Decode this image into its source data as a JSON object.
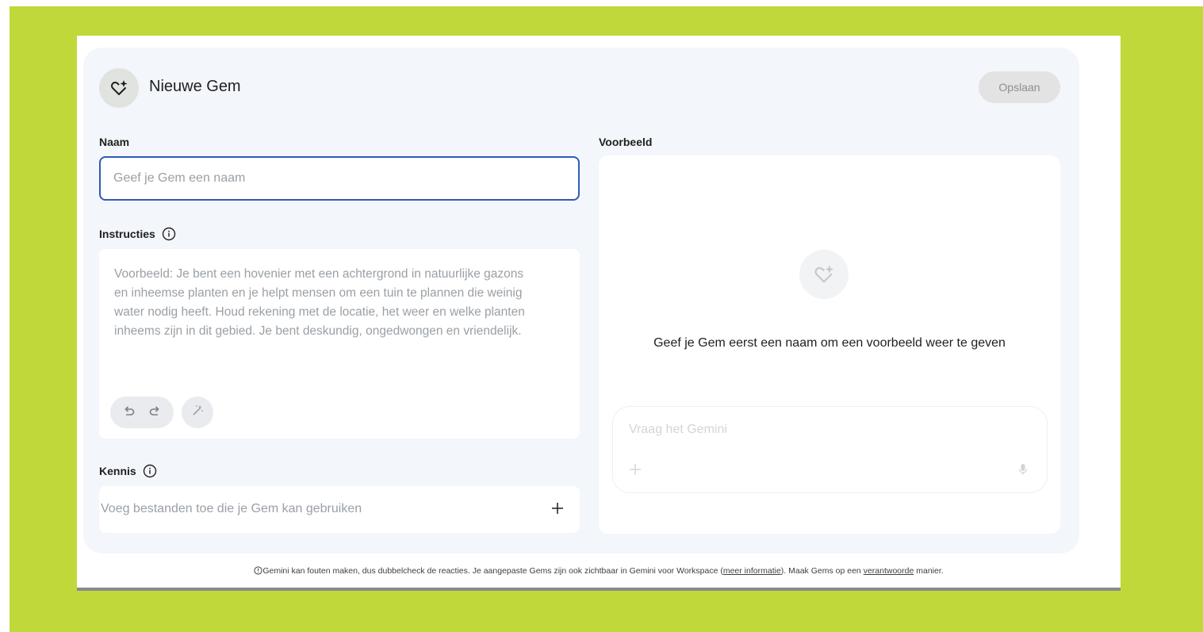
{
  "colors": {
    "background": "#c1d83a",
    "card": "#f3f6fa",
    "focus_border": "#2f5bb5",
    "placeholder": "#9aa0a6"
  },
  "header": {
    "icon": "gem-sparkle-icon",
    "title": "Nieuwe Gem",
    "save_label": "Opslaan"
  },
  "name": {
    "label": "Naam",
    "placeholder": "Geef je Gem een naam",
    "value": ""
  },
  "instructions": {
    "label": "Instructies",
    "info_icon": "info-icon",
    "placeholder_lines": [
      "Voorbeeld: Je bent een hovenier met een achtergrond in natuurlijke gazons",
      "en inheemse planten en je helpt mensen om een tuin te plannen die weinig",
      "water nodig heeft. Houd rekening met de locatie, het weer en welke planten",
      "inheems zijn in dit gebied. Je bent deskundig, ongedwongen en vriendelijk."
    ],
    "undo_icon": "undo-icon",
    "redo_icon": "redo-icon",
    "magic_icon": "magic-wand-icon"
  },
  "knowledge": {
    "label": "Kennis",
    "info_icon": "info-icon",
    "placeholder": "Voeg bestanden toe die je Gem kan gebruiken",
    "add_icon": "plus-icon"
  },
  "preview": {
    "label": "Voorbeeld",
    "message": "Geef je Gem eerst een naam om een voorbeeld weer te geven",
    "chat_placeholder": "Vraag het Gemini",
    "plus_icon": "plus-icon",
    "mic_icon": "microphone-icon"
  },
  "footer": {
    "icon": "info-icon",
    "text_1": "Gemini kan fouten maken, dus dubbelcheck de reacties. Je aangepaste Gems zijn ook zichtbaar in Gemini voor Workspace (",
    "link_1": "meer informatie",
    "text_2": "). Maak Gems op een ",
    "link_2": "verantwoorde",
    "text_3": " manier."
  }
}
